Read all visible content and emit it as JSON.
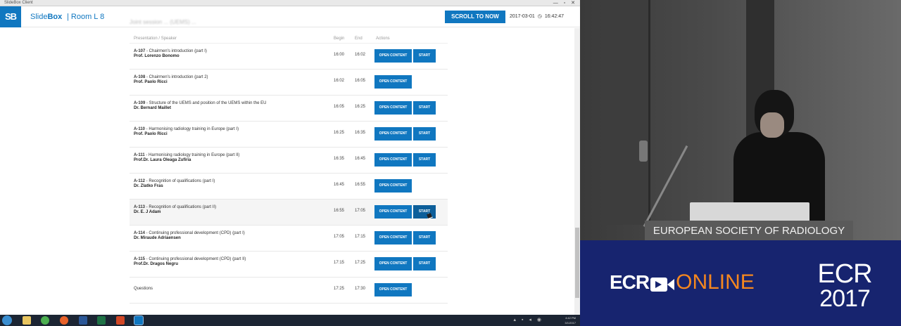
{
  "window": {
    "title": "SlideBox Client",
    "controls": "— ▫ ✕"
  },
  "header": {
    "logo": "SB",
    "brand_part1": "Slide",
    "brand_part2": "Box",
    "room": "| Room L 8",
    "scroll_button": "SCROLL TO NOW",
    "date": "2017-03-01",
    "time": "16:42:47"
  },
  "session_title": "Joint session ... (UEMS) ...",
  "table": {
    "headers": {
      "presentation": "Presentation / Speaker",
      "begin": "Begin",
      "end": "End",
      "actions": "Actions"
    },
    "open_label": "OPEN CONTENT",
    "start_label": "START",
    "rows": [
      {
        "code": "A-107",
        "title": " - Chairmen's introduction (part I)",
        "speaker": "Prof. Lorenzo Bonomo",
        "begin": "16:00",
        "end": "16:02",
        "has_start": true
      },
      {
        "code": "A-108",
        "title": " - Chairmen's introduction (part 2)",
        "speaker": "Prof. Paolo Ricci",
        "begin": "16:02",
        "end": "16:05",
        "has_start": false
      },
      {
        "code": "A-109",
        "title": " - Structure of the UEMS and position of the UEMS within the EU",
        "speaker": "Dr. Bernard Maillet",
        "begin": "16:05",
        "end": "16:25",
        "has_start": true
      },
      {
        "code": "A-110",
        "title": " - Harmonising radiology training in Europe (part I)",
        "speaker": "Prof. Paolo Ricci",
        "begin": "16:25",
        "end": "16:35",
        "has_start": true
      },
      {
        "code": "A-111",
        "title": " - Harmonising radiology training in Europe (part II)",
        "speaker": "Prof.Dr. Laura Oleaga Zufiria",
        "begin": "16:35",
        "end": "16:45",
        "has_start": true
      },
      {
        "code": "A-112",
        "title": " - Recognition of qualifications (part I)",
        "speaker": "Dr. Zlatko Fras",
        "begin": "16:45",
        "end": "16:55",
        "has_start": false
      },
      {
        "code": "A-113",
        "title": " - Recognition of qualifications (part II)",
        "speaker": "Dr. E. J Adam",
        "begin": "16:55",
        "end": "17:05",
        "has_start": true
      },
      {
        "code": "A-114",
        "title": " - Continuing professional development (CPD) (part I)",
        "speaker": "Dr. Miraude Adriaensen",
        "begin": "17:05",
        "end": "17:15",
        "has_start": true
      },
      {
        "code": "A-115",
        "title": " - Continuing professional development (CPD) (part II)",
        "speaker": "Prof.Dr. Dragos Negru",
        "begin": "17:15",
        "end": "17:25",
        "has_start": true
      },
      {
        "code": "",
        "title": "Questions",
        "speaker": "",
        "begin": "17:25",
        "end": "17:30",
        "has_start": false
      }
    ]
  },
  "taskbar": {
    "tray_time": "4:42 PM",
    "tray_date": "3/1/2017",
    "icons": [
      "start-orb",
      "windows-explorer-icon",
      "chrome-icon",
      "firefox-icon",
      "word-icon",
      "excel-icon",
      "powerpoint-icon",
      "slidebox-icon"
    ]
  },
  "video": {
    "podium_label": "EUROPEAN SOCIETY OF RADIOLOGY",
    "banner_ecr": "ECR",
    "banner_online": "ONLINE",
    "logo_ecr": "ECR",
    "logo_year": "2017"
  },
  "colors": {
    "accent": "#1077c0",
    "banner": "#17246f",
    "orange": "#f5871f"
  }
}
